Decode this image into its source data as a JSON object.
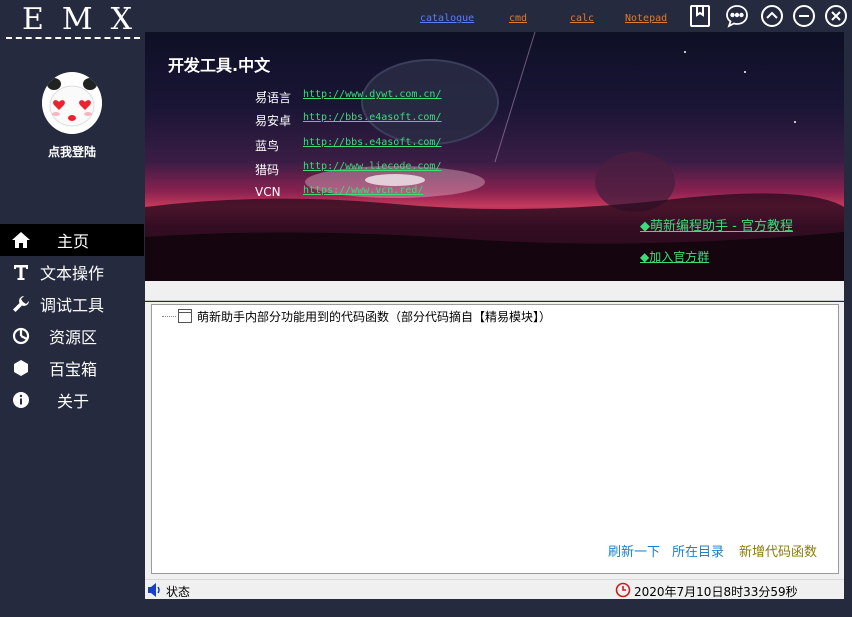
{
  "app": {
    "logo": "EMX"
  },
  "toplinks": {
    "catalogue": "catalogue",
    "cmd": "cmd",
    "calc": "calc",
    "notepad": "Notepad"
  },
  "window_buttons": [
    "book-icon",
    "chat-icon",
    "chevron-up-icon",
    "minimize-icon",
    "close-icon"
  ],
  "sidebar": {
    "login_label": "点我登陆",
    "items": [
      {
        "label": "主页",
        "icon": "home-icon",
        "active": true
      },
      {
        "label": "文本操作",
        "icon": "text-icon",
        "active": false
      },
      {
        "label": "调试工具",
        "icon": "wrench-icon",
        "active": false
      },
      {
        "label": "资源区",
        "icon": "pie-chart-icon",
        "active": false
      },
      {
        "label": "百宝箱",
        "icon": "hexagon-icon",
        "active": false
      },
      {
        "label": "关于",
        "icon": "info-icon",
        "active": false
      }
    ]
  },
  "banner": {
    "title": "开发工具.中文",
    "sites": [
      {
        "name": "易语言",
        "url": "http://www.dywt.com.cn/"
      },
      {
        "name": "易安卓",
        "url": "http://bbs.e4asoft.com/"
      },
      {
        "name": "蓝鸟",
        "url": "http://bbs.e4asoft.com/"
      },
      {
        "name": "猎码",
        "url": "http://www.liecode.com/"
      },
      {
        "name": "VCN",
        "url": "https://www.vcn.red/"
      }
    ],
    "tutorial_link": "◆萌新编程助手 - 官方教程",
    "group_link": "◆加入官方群"
  },
  "tree": {
    "node_label": "萌新助手内部分功能用到的代码函数（部分代码摘自【精易模块】）"
  },
  "actions": {
    "refresh": "刷新一下",
    "open_dir": "所在目录",
    "add_code": "新增代码函数"
  },
  "status": {
    "label": "状态",
    "time": "2020年7月10日8时33分59秒"
  },
  "colors": {
    "sidebar_bg": "#252a3e",
    "link_green": "#3ddc7b",
    "link_orange": "#e07b2c",
    "link_blue": "#5c7bff"
  }
}
